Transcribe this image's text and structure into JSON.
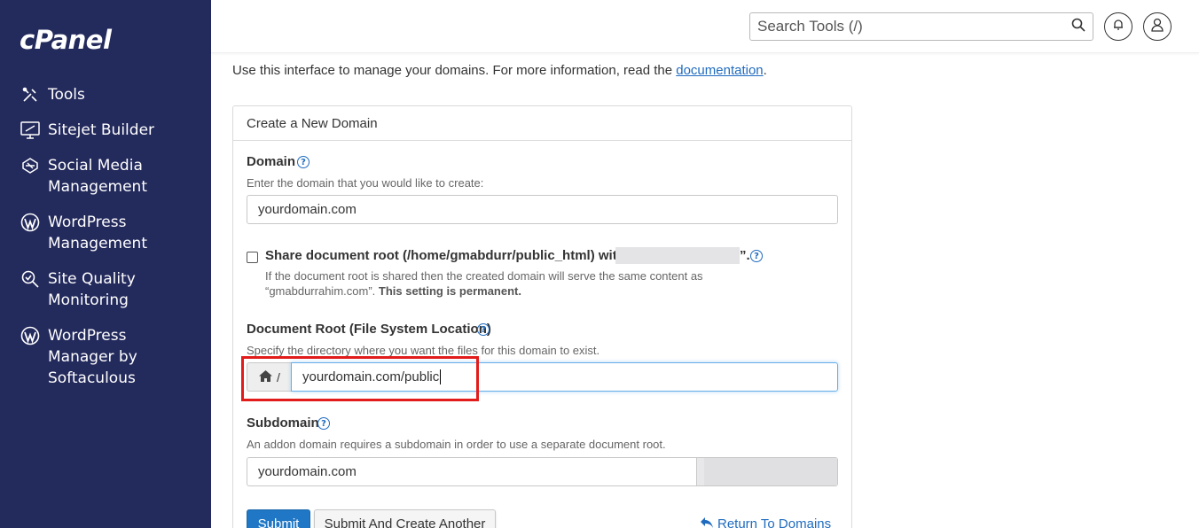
{
  "sidebar": {
    "logo": "cPanel",
    "items": [
      {
        "label": "Tools",
        "icon": "tools-icon"
      },
      {
        "label": "Sitejet Builder",
        "icon": "sitejet-icon"
      },
      {
        "label": "Social Media Management",
        "icon": "social-media-icon"
      },
      {
        "label": "WordPress Management",
        "icon": "wordpress-icon"
      },
      {
        "label": "Site Quality Monitoring",
        "icon": "site-quality-icon"
      },
      {
        "label": "WordPress Manager by Softaculous",
        "icon": "wordpress-icon"
      }
    ]
  },
  "header": {
    "search_placeholder": "Search Tools (/)"
  },
  "intro": {
    "text": "Use this interface to manage your domains. For more information, read the ",
    "link": "documentation",
    "suffix": "."
  },
  "panel": {
    "title": "Create a New Domain",
    "domain": {
      "label": "Domain",
      "hint": "Enter the domain that you would like to create:",
      "value": "yourdomain.com"
    },
    "share": {
      "label_prefix": "Share document root (/home/gmabdurr/public_html) with",
      "label_suffix": "”.",
      "hint_line1": "If the document root is shared then the created domain will serve the same content as",
      "hint_line2": "“gmabdurrahim.com”.",
      "hint_bold": "This setting is permanent."
    },
    "docroot": {
      "label": "Document Root (File System Location)",
      "hint": "Specify the directory where you want the files for this domain to exist.",
      "prefix": "/",
      "value": "yourdomain.com/public"
    },
    "subdomain": {
      "label": "Subdomain",
      "hint": "An addon domain requires a subdomain in order to use a separate document root.",
      "value": "yourdomain.com"
    },
    "buttons": {
      "submit": "Submit",
      "submit_another": "Submit And Create Another",
      "return": "Return To Domains"
    }
  },
  "colors": {
    "sidebar_bg": "#232a5c",
    "link": "#1f6bbf",
    "primary": "#1f77c6",
    "highlight": "#e21b1b"
  }
}
